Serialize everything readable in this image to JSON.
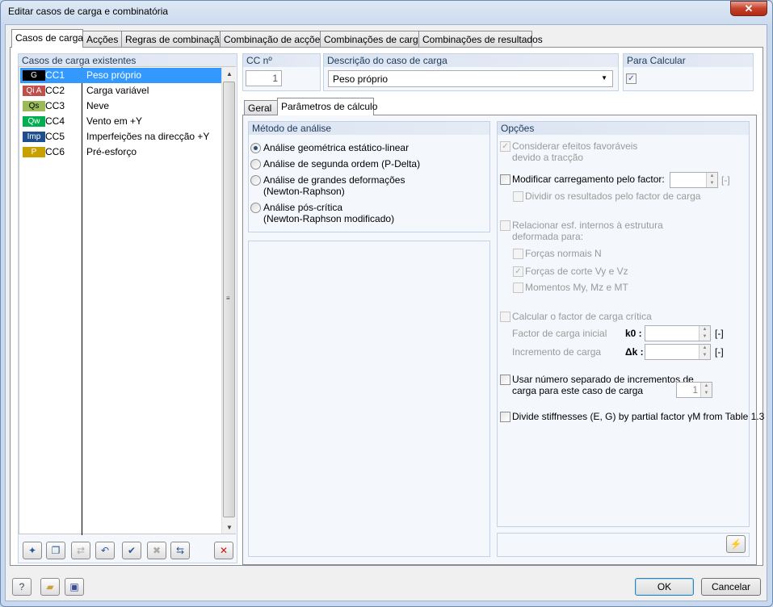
{
  "window": {
    "title": "Editar casos de carga e combinatória",
    "close": "✕"
  },
  "tabs": [
    "Casos de carga",
    "Acções",
    "Regras de combinação",
    "Combinação de acções",
    "Combinações de carga",
    "Combinações de resultados"
  ],
  "left": {
    "header": "Casos de carga existentes",
    "rows": [
      {
        "badge": "G",
        "badge_color": "#000000",
        "badge_text": "#ffffff",
        "cc": "CC1",
        "desc": "Peso próprio",
        "selected": true
      },
      {
        "badge": "Qi A",
        "badge_color": "#c0504d",
        "badge_text": "#ffffff",
        "cc": "CC2",
        "desc": "Carga variável"
      },
      {
        "badge": "Qs",
        "badge_color": "#9bbb59",
        "badge_text": "#000000",
        "cc": "CC3",
        "desc": "Neve"
      },
      {
        "badge": "Qw",
        "badge_color": "#00b050",
        "badge_text": "#ffffff",
        "cc": "CC4",
        "desc": "Vento em +Y"
      },
      {
        "badge": "Imp",
        "badge_color": "#1f4e8c",
        "badge_text": "#ffffff",
        "cc": "CC5",
        "desc": "Imperfeições na direcção +Y"
      },
      {
        "badge": "P",
        "badge_color": "#c8a000",
        "badge_text": "#ffffff",
        "cc": "CC6",
        "desc": "Pré-esforço"
      }
    ],
    "toolbar": [
      "new-load-case-icon",
      "copy-load-case-icon",
      "renumber-icon",
      "text-format-icon",
      "check-list-icon",
      "uncheck-list-icon",
      "toggle-selection-icon",
      "delete-icon"
    ]
  },
  "cc": {
    "label": "CC nº",
    "value": "1"
  },
  "description": {
    "label": "Descrição do caso de carga",
    "value": "Peso próprio"
  },
  "calc": {
    "label": "Para Calcular",
    "checked": true
  },
  "subtabs": [
    "Geral",
    "Parâmetros de cálculo"
  ],
  "method": {
    "header": "Método de análise",
    "options": [
      {
        "l1": "Análise geométrica estático-linear",
        "l2": "",
        "selected": true
      },
      {
        "l1": "Análise de segunda ordem (P-Delta)",
        "l2": ""
      },
      {
        "l1": "Análise de grandes deformações",
        "l2": "(Newton-Raphson)"
      },
      {
        "l1": "Análise pós-crítica",
        "l2": "(Newton-Raphson modificado)"
      }
    ]
  },
  "options": {
    "header": "Opções",
    "favor_l1": "Considerar efeitos favoráveis",
    "favor_l2": "devido a tracção",
    "modify": "Modificar carregamento pelo factor:",
    "unit": "[-]",
    "divide_results": "Dividir os resultados pelo factor de carga",
    "relate_l1": "Relacionar esf. internos à estrutura",
    "relate_l2": "deformada para:",
    "normal": "Forças normais N",
    "shear": "Forças de corte Vy e Vz",
    "moments": "Momentos My, Mz e MT",
    "critical": "Calcular o factor de carga crítica",
    "initial": "Factor de carga inicial",
    "k0": "k0 :",
    "increment": "Incremento de carga",
    "dk": "Δk :",
    "separate_l1": "Usar número separado de incrementos de",
    "separate_l2": "carga para este caso de carga",
    "separate_value": "1",
    "stiff": "Divide stiffnesses (E, G) by partial factor γM from Table 1.3"
  },
  "footer": {
    "ok": "OK",
    "cancel": "Cancelar"
  }
}
